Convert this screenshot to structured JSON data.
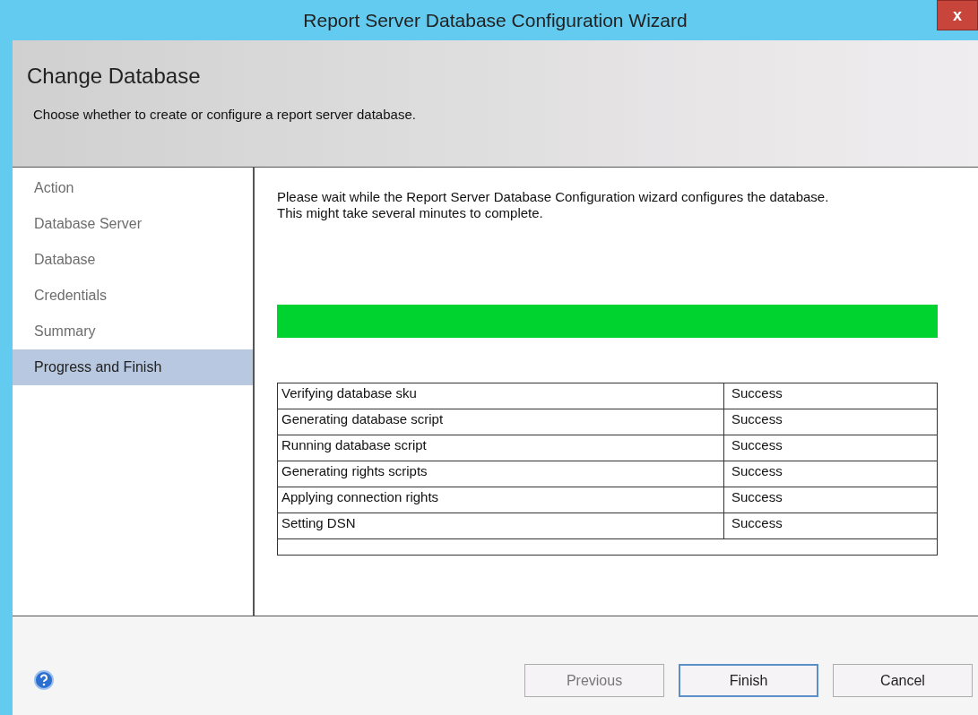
{
  "window": {
    "title": "Report Server Database Configuration Wizard",
    "close": "x"
  },
  "header": {
    "title": "Change Database",
    "subtitle": "Choose whether to create or configure a report server database."
  },
  "sidebar": {
    "items": [
      {
        "label": "Action",
        "selected": false
      },
      {
        "label": "Database Server",
        "selected": false
      },
      {
        "label": "Database",
        "selected": false
      },
      {
        "label": "Credentials",
        "selected": false
      },
      {
        "label": "Summary",
        "selected": false
      },
      {
        "label": "Progress and Finish",
        "selected": true
      }
    ]
  },
  "content": {
    "message": "Please wait while the Report Server Database Configuration wizard configures the database.  This might take several minutes to complete.",
    "progress": {
      "level": 1
    },
    "table": {
      "rows": [
        {
          "step": "Verifying database sku",
          "result": "Success"
        },
        {
          "step": "Generating database script",
          "result": "Success"
        },
        {
          "step": "Running database script",
          "result": "Success"
        },
        {
          "step": "Generating rights scripts",
          "result": "Success"
        },
        {
          "step": "Applying connection rights",
          "result": "Success"
        },
        {
          "step": "Setting DSN",
          "result": "Success"
        }
      ]
    }
  },
  "footer": {
    "buttons": [
      {
        "label": "Previous",
        "disabled": true,
        "default": false
      },
      {
        "label": "Finish",
        "disabled": false,
        "default": true
      },
      {
        "label": "Cancel",
        "disabled": false,
        "default": false
      }
    ]
  }
}
